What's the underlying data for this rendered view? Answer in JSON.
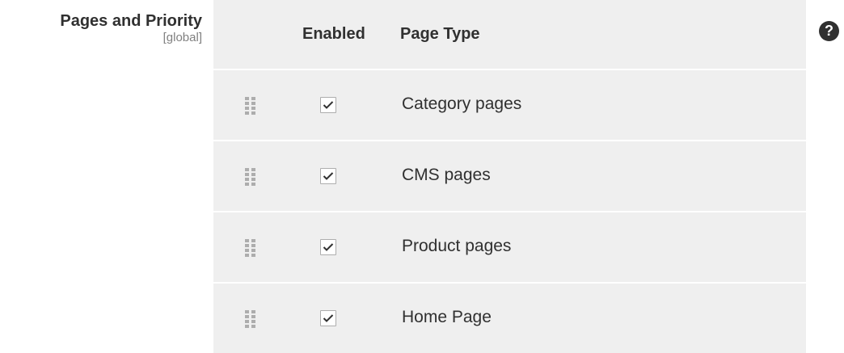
{
  "field": {
    "label": "Pages and Priority",
    "scope": "[global]"
  },
  "grid": {
    "headers": {
      "enabled": "Enabled",
      "page_type": "Page Type"
    },
    "rows": [
      {
        "label": "Category pages",
        "enabled": true
      },
      {
        "label": "CMS pages",
        "enabled": true
      },
      {
        "label": "Product pages",
        "enabled": true
      },
      {
        "label": "Home Page",
        "enabled": true
      }
    ]
  },
  "help": {
    "icon": "question-circle-icon",
    "glyph": "?"
  },
  "colors": {
    "grid_background": "#efefef",
    "text": "#303030",
    "muted": "#808080",
    "handle": "#adadad"
  }
}
